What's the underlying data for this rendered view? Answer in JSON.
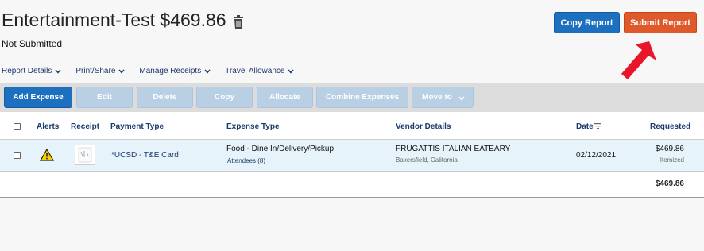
{
  "report": {
    "title": "Entertainment-Test $469.86",
    "status": "Not Submitted"
  },
  "actions": {
    "copy_label": "Copy Report",
    "submit_label": "Submit Report"
  },
  "menus": [
    {
      "label": "Report Details"
    },
    {
      "label": "Print/Share"
    },
    {
      "label": "Manage Receipts"
    },
    {
      "label": "Travel Allowance"
    }
  ],
  "toolbar": {
    "add": "Add Expense",
    "edit": "Edit",
    "delete": "Delete",
    "copy": "Copy",
    "allocate": "Allocate",
    "combine": "Combine Expenses",
    "move": "Move to"
  },
  "table": {
    "headers": {
      "alerts": "Alerts",
      "receipt": "Receipt",
      "payment_type": "Payment Type",
      "expense_type": "Expense Type",
      "vendor": "Vendor Details",
      "date": "Date",
      "requested": "Requested"
    },
    "rows": [
      {
        "payment_type": "*UCSD - T&E Card",
        "expense_type": "Food - Dine In/Delivery/Pickup",
        "attendees": "Attendees (8)",
        "vendor": "FRUGATTIS ITALIAN EATEARY",
        "location": "Bakersfield, California",
        "date": "02/12/2021",
        "amount": "$469.86",
        "amount_note": "Itemized"
      }
    ],
    "total": "$469.86"
  },
  "colors": {
    "primary": "#1d6fbf",
    "submit": "#e0592a",
    "arrow": "#e8162a",
    "alert": "#f5d000"
  }
}
